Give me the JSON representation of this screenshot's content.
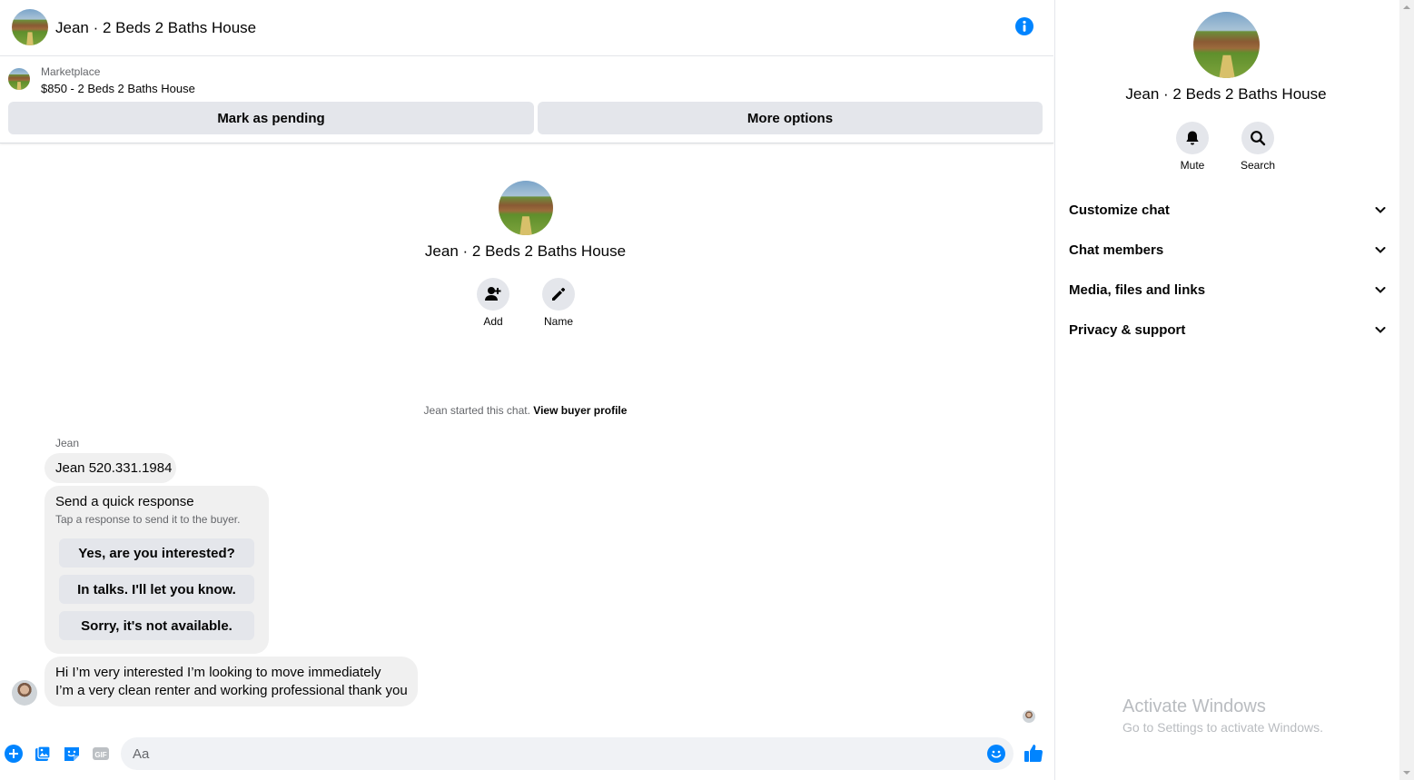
{
  "header": {
    "title": "Jean · 2 Beds 2 Baths House"
  },
  "listing": {
    "source": "Marketplace",
    "title": "$850 - 2 Beds 2 Baths House",
    "mark_pending": "Mark as pending",
    "more_options": "More options"
  },
  "intro": {
    "title": "Jean · 2 Beds 2 Baths House",
    "add_label": "Add",
    "name_label": "Name"
  },
  "chat": {
    "started_text": "Jean started this chat.",
    "view_profile": "View buyer profile",
    "sender": "Jean",
    "msg1": "Jean 520.331.1984",
    "quick_title": "Send a quick response",
    "quick_sub": "Tap a response to send it to the buyer.",
    "quick_1": "Yes, are you interested?",
    "quick_2": "In talks. I'll let you know.",
    "quick_3": "Sorry, it's not available.",
    "msg2_line1": "Hi I’m very interested I’m looking to move immediately",
    "msg2_line2": "I’m a very clean renter and working professional thank you"
  },
  "composer": {
    "placeholder": "Aa"
  },
  "sidebar": {
    "title": "Jean · 2 Beds 2 Baths House",
    "mute": "Mute",
    "search": "Search",
    "sections": [
      "Customize chat",
      "Chat members",
      "Media, files and links",
      "Privacy & support"
    ]
  },
  "watermark": {
    "line1": "Activate Windows",
    "line2": "Go to Settings to activate Windows."
  },
  "colors": {
    "accent": "#0084ff",
    "gray_button": "#e4e6eb",
    "bubble": "#f0f0f0"
  }
}
